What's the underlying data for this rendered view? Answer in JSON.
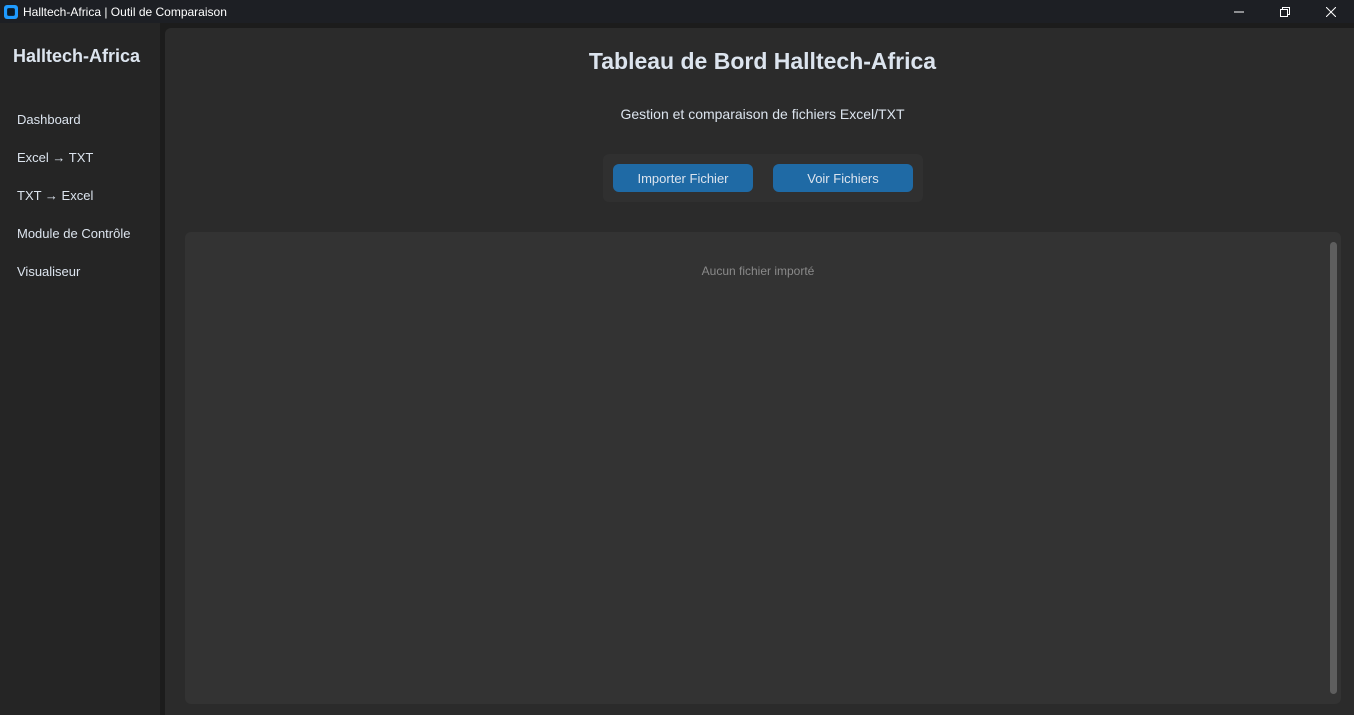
{
  "window": {
    "title": "Halltech-Africa | Outil de Comparaison",
    "controls": {
      "minimize": "—",
      "restore": "❐",
      "close": "✕"
    }
  },
  "sidebar": {
    "title": "Halltech-Africa",
    "items": [
      {
        "label": "Dashboard"
      },
      {
        "label": "Excel → TXT"
      },
      {
        "label": "TXT → Excel"
      },
      {
        "label": "Module de Contrôle"
      },
      {
        "label": "Visualiseur"
      }
    ]
  },
  "main": {
    "title": "Tableau de Bord Halltech-Africa",
    "subtitle": "Gestion et comparaison de fichiers Excel/TXT",
    "buttons": {
      "import": "Importer Fichier",
      "view": "Voir Fichiers"
    },
    "files_panel": {
      "empty_message": "Aucun fichier importé"
    }
  },
  "colors": {
    "accent": "#1f6aa5",
    "background": "#2b2b2b",
    "sidebar": "#252525",
    "text": "#dce4ee",
    "muted_text": "#8a8a8a"
  }
}
